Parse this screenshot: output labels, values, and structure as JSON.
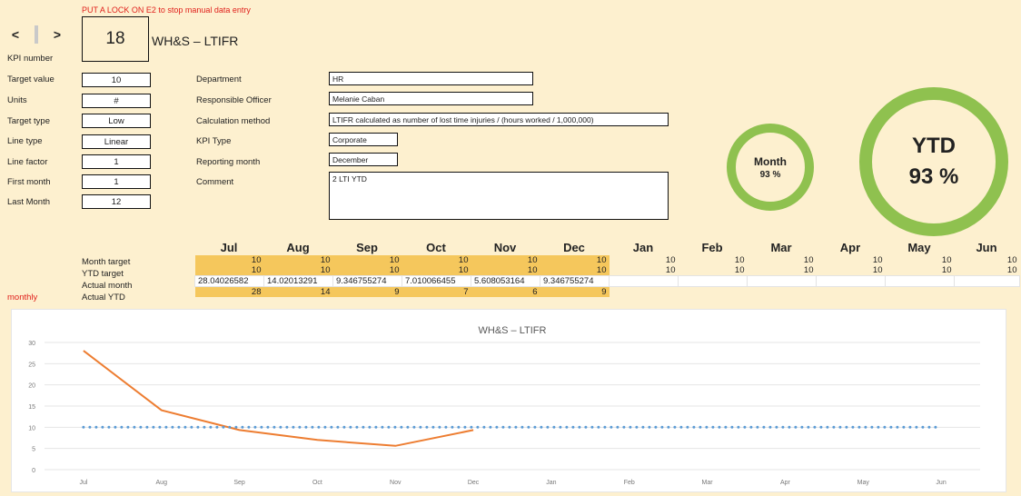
{
  "warning": "PUT A LOCK ON E2 to stop manual data entry",
  "kpi": {
    "number": "18",
    "number_label": "KPI number",
    "title": "WH&S – LTIFR",
    "nav_prev": "<",
    "nav_next": ">"
  },
  "left_fields": [
    {
      "label": "Target value",
      "value": "10"
    },
    {
      "label": "Units",
      "value": "#"
    },
    {
      "label": "Target type",
      "value": "Low"
    },
    {
      "label": "Line type",
      "value": "Linear"
    },
    {
      "label": "Line factor",
      "value": "1"
    },
    {
      "label": "First month",
      "value": "1"
    },
    {
      "label": "Last Month",
      "value": "12"
    }
  ],
  "right_fields": [
    {
      "label": "Department",
      "value": "HR"
    },
    {
      "label": "Responsible Officer",
      "value": "Melanie Caban"
    },
    {
      "label": "Calculation method",
      "value": "LTIFR calculated as number of lost time injuries / (hours worked / 1,000,000)"
    },
    {
      "label": "KPI Type",
      "value": "Corporate"
    },
    {
      "label": "Reporting month",
      "value": "December"
    },
    {
      "label": "Comment",
      "value": "2 LTI YTD"
    }
  ],
  "gauges": {
    "month_label": "Month",
    "month_value": "93 %",
    "ytd_label": "YTD",
    "ytd_value": "93 %",
    "ring_color": "#8fc14f"
  },
  "months": [
    "Jul",
    "Aug",
    "Sep",
    "Oct",
    "Nov",
    "Dec",
    "Jan",
    "Feb",
    "Mar",
    "Apr",
    "May",
    "Jun"
  ],
  "table": {
    "side_label": "monthly",
    "rows": [
      {
        "label": "Month target",
        "values": [
          "10",
          "10",
          "10",
          "10",
          "10",
          "10",
          "10",
          "10",
          "10",
          "10",
          "10",
          "10"
        ]
      },
      {
        "label": "YTD target",
        "values": [
          "10",
          "10",
          "10",
          "10",
          "10",
          "10",
          "10",
          "10",
          "10",
          "10",
          "10",
          "10"
        ]
      },
      {
        "label": "Actual month",
        "values": [
          "28.04026582",
          "14.02013291",
          "9.346755274",
          "7.010066455",
          "5.608053164",
          "9.346755274",
          "",
          "",
          "",
          "",
          "",
          ""
        ]
      },
      {
        "label": "Actual YTD",
        "values": [
          "28",
          "14",
          "9",
          "7",
          "6",
          "9",
          "",
          "",
          "",
          "",
          "",
          ""
        ]
      }
    ]
  },
  "chart_data": {
    "type": "line",
    "title": "WH&S – LTIFR",
    "categories": [
      "Jul",
      "Aug",
      "Sep",
      "Oct",
      "Nov",
      "Dec",
      "Jan",
      "Feb",
      "Mar",
      "Apr",
      "May",
      "Jun"
    ],
    "ylim": [
      0,
      30
    ],
    "yticks": [
      0,
      5,
      10,
      15,
      20,
      25,
      30
    ],
    "grid": true,
    "series": [
      {
        "values": [
          28.04,
          14.02,
          9.35,
          7.01,
          5.61,
          9.35,
          null,
          null,
          null,
          null,
          null,
          null
        ],
        "color": "#ed7d31",
        "style": "solid"
      },
      {
        "values": [
          10,
          10,
          10,
          10,
          10,
          10,
          10,
          10,
          10,
          10,
          10,
          10
        ],
        "color": "#5b9bd5",
        "style": "dotted"
      }
    ]
  }
}
